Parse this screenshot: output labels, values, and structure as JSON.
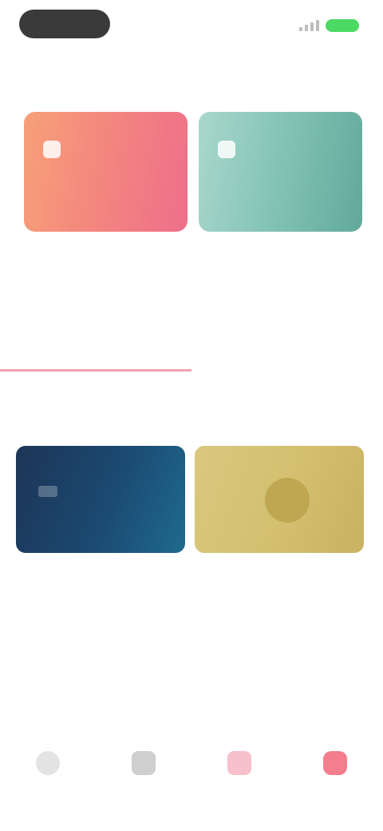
{
  "status_bar": {
    "signal_icon": "signal-bars-icon",
    "battery_icon": "battery-icon",
    "battery_color": "#4cd964"
  },
  "header": {
    "title": "",
    "link": ""
  },
  "promo_cards": [
    {
      "title": "",
      "subtitle": "",
      "color": "#f3857f"
    },
    {
      "title": "",
      "subtitle": "",
      "color": "#7ec0b2"
    }
  ],
  "segment": {
    "tabs": [
      {
        "label": "",
        "active": true
      },
      {
        "label": "",
        "active": false
      }
    ],
    "accent": "#e95b72"
  },
  "section": {
    "title": "",
    "link": ""
  },
  "products": [
    {
      "caption": "",
      "subcaption": "",
      "color": "#1b4a72"
    },
    {
      "caption": "",
      "color": "#d3bf6f"
    }
  ],
  "tab_bar": [
    {
      "icon": "home-icon",
      "label": ""
    },
    {
      "icon": "discover-icon",
      "label": ""
    },
    {
      "icon": "favorites-icon",
      "label": ""
    },
    {
      "icon": "profile-icon",
      "label": ""
    }
  ]
}
